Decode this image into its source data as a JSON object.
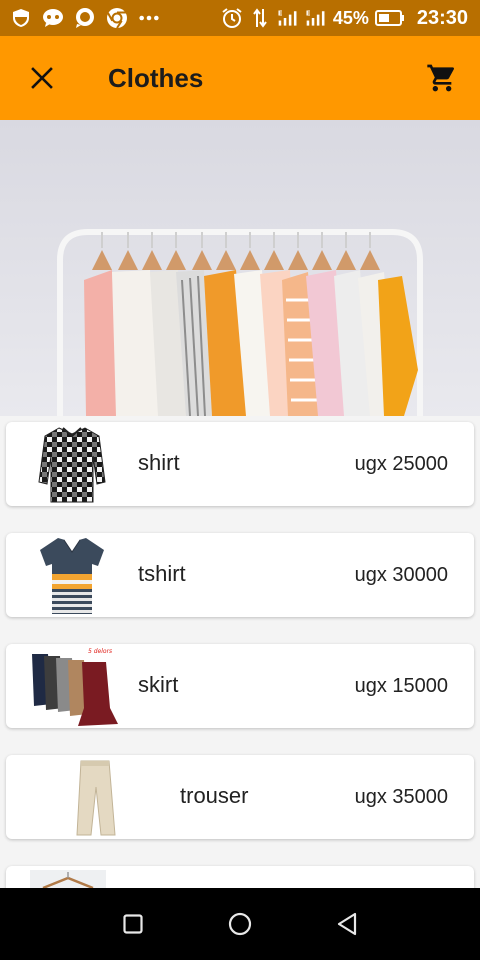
{
  "status_bar": {
    "battery_percent": "45%",
    "time": "23:30",
    "icons": [
      "shield-icon",
      "messenger-icon",
      "chat-icon",
      "chrome-icon",
      "more-dots-icon",
      "alarm-icon",
      "data-arrows-icon",
      "signal-e-icon",
      "signal-e-icon",
      "battery-icon"
    ]
  },
  "app_bar": {
    "title": "Clothes",
    "close_icon": "close-icon",
    "cart_icon": "cart-icon",
    "color": "#ff9800"
  },
  "hero": {
    "image": "clothes-rack-image"
  },
  "products": [
    {
      "name": "shirt",
      "price": "ugx 25000",
      "image": "plaid-shirt-image"
    },
    {
      "name": "tshirt",
      "price": "ugx 30000",
      "image": "polo-shirt-image"
    },
    {
      "name": "skirt",
      "price": "ugx 15000",
      "image": "skirts-image",
      "image_caption": "5 delors"
    },
    {
      "name": "trouser",
      "price": "ugx 35000",
      "image": "trouser-image"
    },
    {
      "name": "",
      "price": "",
      "image": "hanger-clothing-image"
    }
  ],
  "nav_bar": {
    "buttons": [
      "recents-square-icon",
      "home-circle-icon",
      "back-triangle-icon"
    ]
  }
}
